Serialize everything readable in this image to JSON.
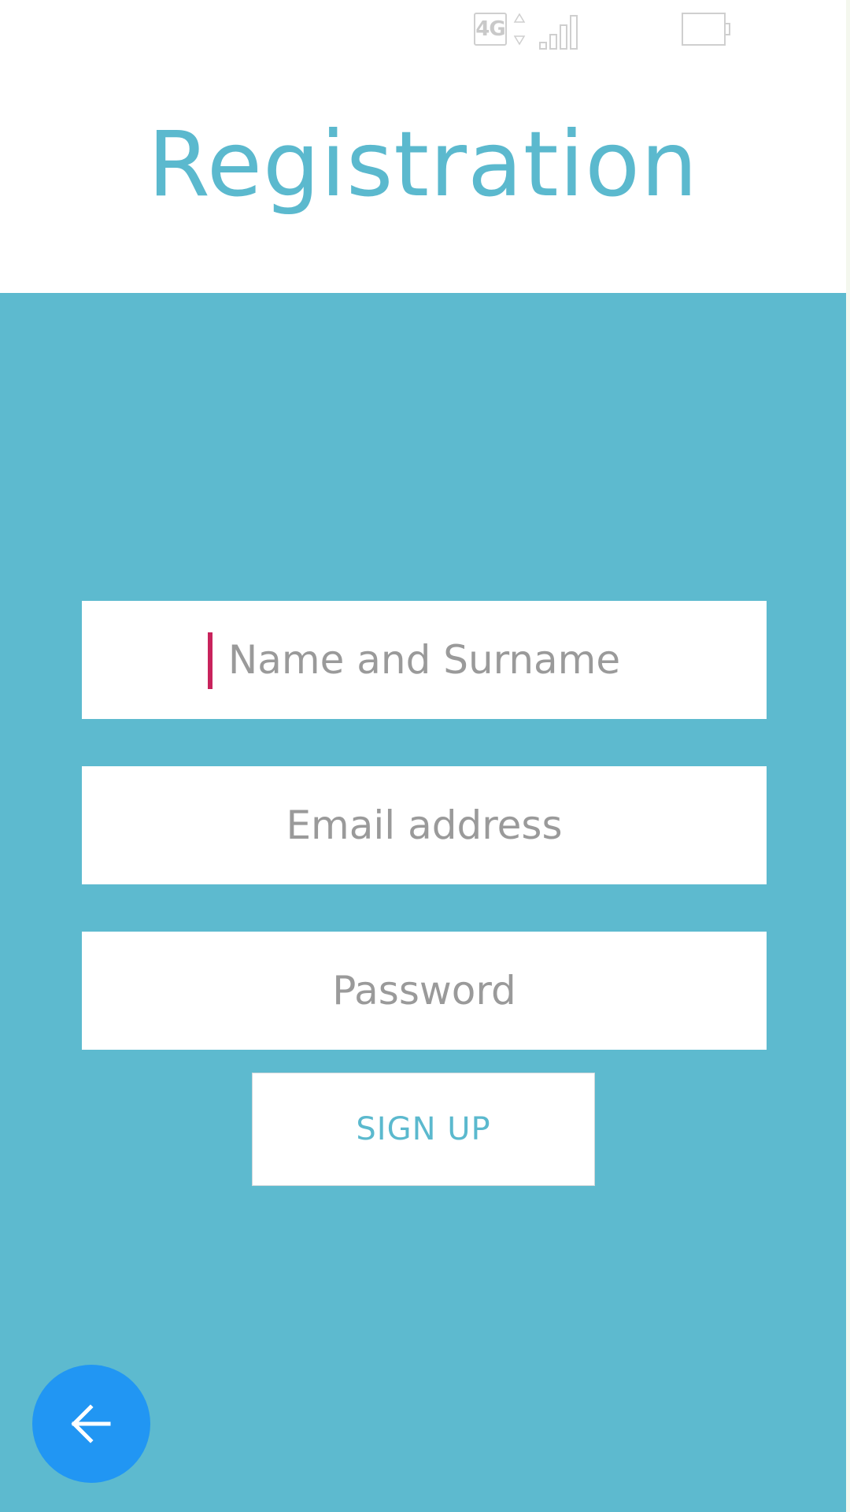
{
  "status_bar": {
    "network_label": "4G",
    "icons": [
      "network-4g-icon",
      "data-arrows-icon",
      "signal-icon",
      "battery-icon"
    ]
  },
  "header": {
    "title": "Registration"
  },
  "form": {
    "name_placeholder": "Name and Surname",
    "name_value": "",
    "email_placeholder": "Email address",
    "email_value": "",
    "password_placeholder": "Password",
    "password_value": "",
    "signup_label": "SIGN UP"
  },
  "fab": {
    "icon": "arrow-back-icon"
  },
  "colors": {
    "accent": "#5bb9ce",
    "panel": "#5dbacf",
    "fab": "#2196f3",
    "cursor": "#c8235c",
    "placeholder": "#9a9a9a"
  }
}
